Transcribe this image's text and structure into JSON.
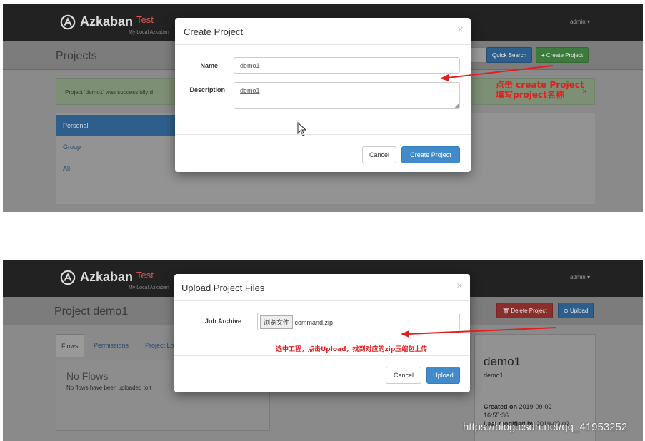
{
  "brand": {
    "name": "Azkaban",
    "env": "Test",
    "subtitle": "My Local Azkaban"
  },
  "user_menu": "admin",
  "panel1": {
    "page_title": "Projects",
    "quick_search_label": "Quick Search",
    "create_project_label": "Create Project",
    "alert_text": "Project 'demo1' was successfully d",
    "sidebar_items": [
      "Personal",
      "Group",
      "All"
    ],
    "modal": {
      "title": "Create Project",
      "name_label": "Name",
      "name_value": "demo1",
      "description_label": "Description",
      "description_value": "demo1",
      "cancel_label": "Cancel",
      "submit_label": "Create Project"
    },
    "annotation": [
      "点击 create Project",
      "填写project名称"
    ]
  },
  "panel2": {
    "page_title": "Project demo1",
    "delete_label": "Delete Project",
    "upload_label": "Upload",
    "tabs": [
      "Flows",
      "Permissions",
      "Project Lo"
    ],
    "no_flows_title": "No Flows",
    "no_flows_text": "No flows have been uploaded to t",
    "card": {
      "name": "demo1",
      "desc": "demo1",
      "created_label": "Created on",
      "created_date": "2019-09-02",
      "created_time": "16:55:36",
      "modified_label": "Last modified by",
      "modified_date": "2019-09-02"
    },
    "modal": {
      "title": "Upload Project Files",
      "archive_label": "Job Archive",
      "browse_label": "浏览文件",
      "file_name": "command.zip",
      "cancel_label": "Cancel",
      "submit_label": "Upload"
    },
    "annotation": "选中工程，点击Upload，找到对应的zip压缩包上传"
  },
  "watermark": "https://blog.csdn.net/qq_41953252",
  "colors": {
    "annotation": "#e02020",
    "primary": "#428bca",
    "success": "#5cb85c",
    "danger": "#d9534f"
  }
}
